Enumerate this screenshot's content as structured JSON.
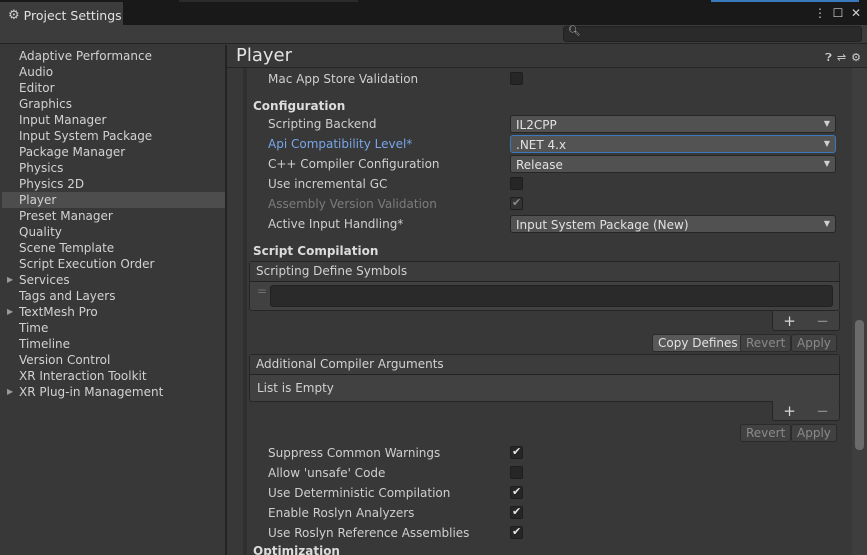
{
  "window": {
    "tab_title": "Project Settings",
    "controls": [
      "⋮",
      "☐",
      "✕"
    ]
  },
  "search": {
    "placeholder": ""
  },
  "sidebar": {
    "items": [
      {
        "label": "Adaptive Performance",
        "expandable": false,
        "selected": false
      },
      {
        "label": "Audio",
        "expandable": false,
        "selected": false
      },
      {
        "label": "Editor",
        "expandable": false,
        "selected": false
      },
      {
        "label": "Graphics",
        "expandable": false,
        "selected": false
      },
      {
        "label": "Input Manager",
        "expandable": false,
        "selected": false
      },
      {
        "label": "Input System Package",
        "expandable": false,
        "selected": false
      },
      {
        "label": "Package Manager",
        "expandable": false,
        "selected": false
      },
      {
        "label": "Physics",
        "expandable": false,
        "selected": false
      },
      {
        "label": "Physics 2D",
        "expandable": false,
        "selected": false
      },
      {
        "label": "Player",
        "expandable": false,
        "selected": true
      },
      {
        "label": "Preset Manager",
        "expandable": false,
        "selected": false
      },
      {
        "label": "Quality",
        "expandable": false,
        "selected": false
      },
      {
        "label": "Scene Template",
        "expandable": false,
        "selected": false
      },
      {
        "label": "Script Execution Order",
        "expandable": false,
        "selected": false
      },
      {
        "label": "Services",
        "expandable": true,
        "selected": false
      },
      {
        "label": "Tags and Layers",
        "expandable": false,
        "selected": false
      },
      {
        "label": "TextMesh Pro",
        "expandable": true,
        "selected": false
      },
      {
        "label": "Time",
        "expandable": false,
        "selected": false
      },
      {
        "label": "Timeline",
        "expandable": false,
        "selected": false
      },
      {
        "label": "Version Control",
        "expandable": false,
        "selected": false
      },
      {
        "label": "XR Interaction Toolkit",
        "expandable": false,
        "selected": false
      },
      {
        "label": "XR Plug-in Management",
        "expandable": true,
        "selected": false
      }
    ]
  },
  "main": {
    "title": "Player",
    "header_icons": [
      "help-icon",
      "preset-icon",
      "settings-icon"
    ],
    "mac_validation": {
      "label": "Mac App Store Validation",
      "checked": false
    },
    "configuration": {
      "heading": "Configuration",
      "scripting_backend": {
        "label": "Scripting Backend",
        "value": "IL2CPP"
      },
      "api_level": {
        "label": "Api Compatibility Level*",
        "value": ".NET 4.x"
      },
      "cpp_config": {
        "label": "C++ Compiler Configuration",
        "value": "Release"
      },
      "incremental_gc": {
        "label": "Use incremental GC",
        "checked": false
      },
      "assembly_validation": {
        "label": "Assembly Version Validation",
        "checked": true
      },
      "input_handling": {
        "label": "Active Input Handling*",
        "value": "Input System Package (New)"
      }
    },
    "script_compilation": {
      "heading": "Script Compilation",
      "define_symbols": {
        "header": "Scripting Define Symbols",
        "handle": "="
      },
      "copy_defines": "Copy Defines",
      "revert": "Revert",
      "apply": "Apply",
      "compiler_args": {
        "header": "Additional Compiler Arguments",
        "empty_text": "List is Empty"
      },
      "plus": "+",
      "minus": "−"
    },
    "warnings": [
      {
        "label": "Suppress Common Warnings",
        "checked": true
      },
      {
        "label": "Allow 'unsafe' Code",
        "checked": false
      },
      {
        "label": "Use Deterministic Compilation",
        "checked": true
      },
      {
        "label": "Enable Roslyn Analyzers",
        "checked": true
      },
      {
        "label": "Use Roslyn Reference Assemblies",
        "checked": true
      }
    ],
    "optimization_heading": "Optimization"
  }
}
